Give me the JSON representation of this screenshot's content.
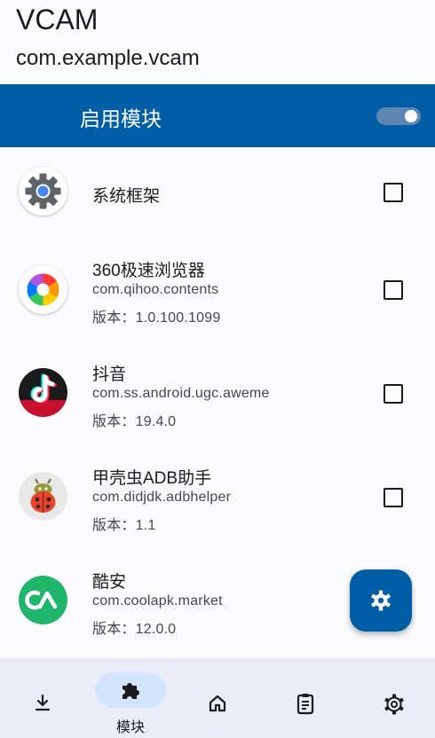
{
  "header": {
    "title": "VCAM",
    "subtitle": "com.example.vcam"
  },
  "module_bar": {
    "label": "启用模块",
    "enabled": true
  },
  "apps": [
    {
      "name": "系统框架",
      "icon": "system-framework-gear-icon",
      "checked": false
    },
    {
      "name": "360极速浏览器",
      "package": "com.qihoo.contents",
      "version": "版本：1.0.100.1099",
      "icon": "360-browser-icon",
      "checked": false
    },
    {
      "name": "抖音",
      "package": "com.ss.android.ugc.aweme",
      "version": "版本：19.4.0",
      "icon": "douyin-icon",
      "checked": false
    },
    {
      "name": "甲壳虫ADB助手",
      "package": "com.didjdk.adbhelper",
      "version": "版本：1.1",
      "icon": "ladybug-icon",
      "checked": false
    },
    {
      "name": "酷安",
      "package": "com.coolapk.market",
      "version": "版本：12.0.0",
      "icon": "coolapk-icon"
    }
  ],
  "fab": {
    "icon": "settings-gear-icon"
  },
  "bottom_nav": {
    "active_label": "模块",
    "items": [
      "download-icon",
      "puzzle-icon",
      "home-icon",
      "clipboard-icon",
      "gear-icon"
    ]
  },
  "colors": {
    "primary": "#005ea6",
    "background": "#fbfbfe",
    "nav_background": "#eaedf6",
    "nav_pill": "#d3e4ff"
  }
}
